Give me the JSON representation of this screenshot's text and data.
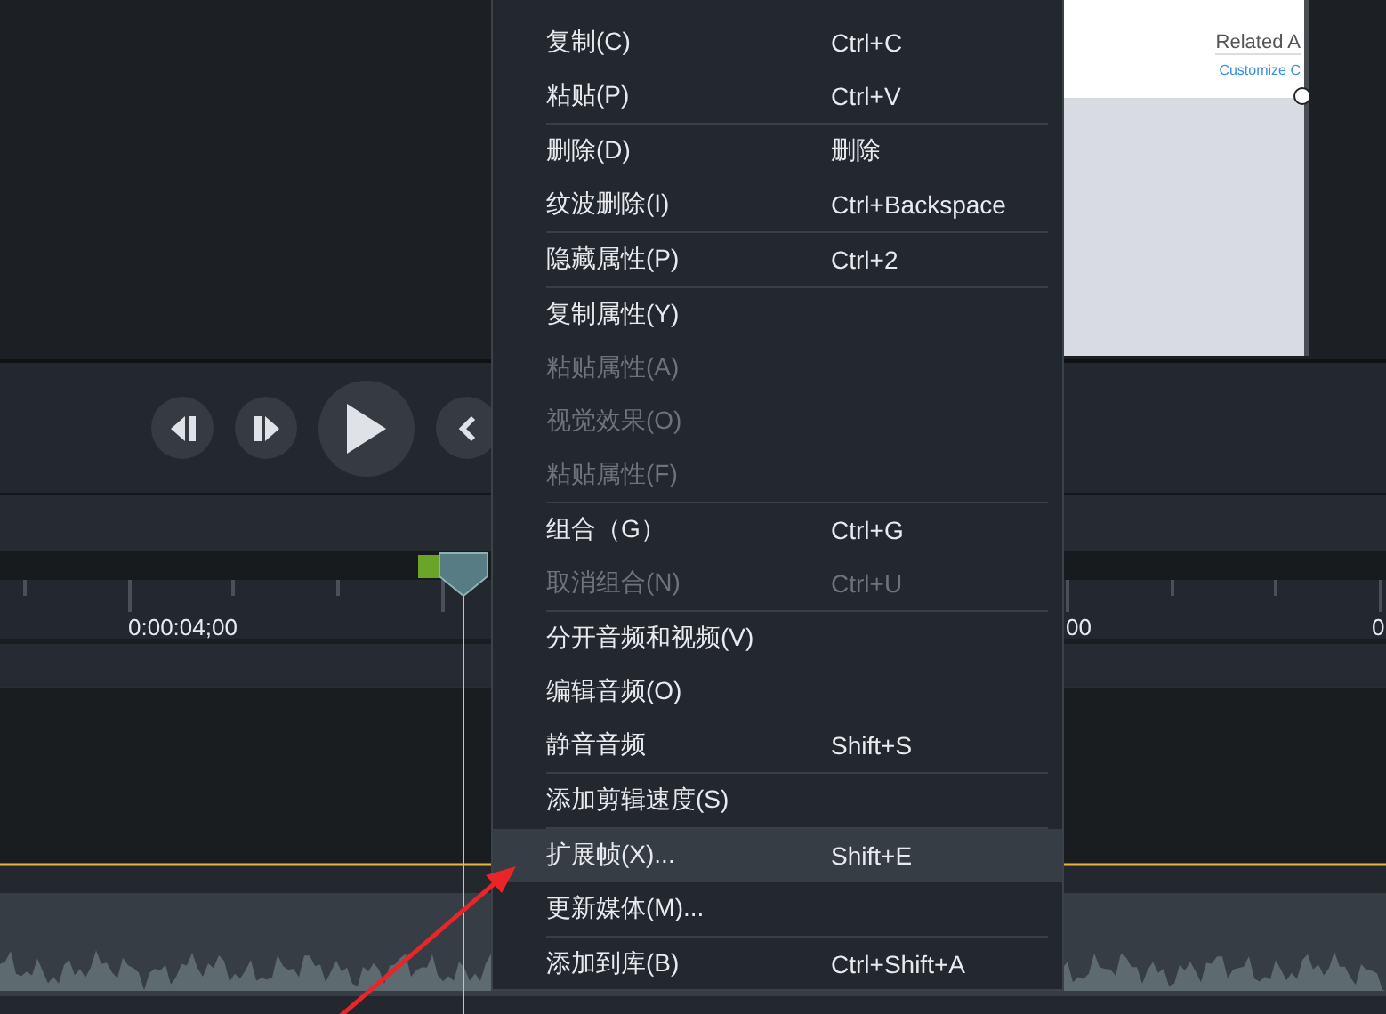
{
  "preview": {
    "canvas_texts": [
      {
        "kind": "heading",
        "text": "Related A"
      },
      {
        "kind": "link",
        "text": "Customize C"
      }
    ]
  },
  "timeline": {
    "ruler_labels": [
      "0:00:04;00",
      "00",
      "0"
    ]
  },
  "context_menu": {
    "groups": [
      [
        {
          "label": "复制(C)",
          "shortcut": "Ctrl+C",
          "disabled": false,
          "selected": false
        },
        {
          "label": "粘贴(P)",
          "shortcut": "Ctrl+V",
          "disabled": false,
          "selected": false
        }
      ],
      [
        {
          "label": "删除(D)",
          "shortcut": "删除",
          "disabled": false,
          "selected": false
        },
        {
          "label": "纹波删除(I)",
          "shortcut": "Ctrl+Backspace",
          "disabled": false,
          "selected": false
        }
      ],
      [
        {
          "label": "隐藏属性(P)",
          "shortcut": "Ctrl+2",
          "disabled": false,
          "selected": false
        }
      ],
      [
        {
          "label": "复制属性(Y)",
          "disabled": false,
          "selected": false
        },
        {
          "label": "粘贴属性(A)",
          "disabled": true,
          "selected": false
        },
        {
          "label": "视觉效果(O)",
          "disabled": true,
          "selected": false
        },
        {
          "label": "粘贴属性(F)",
          "disabled": true,
          "selected": false
        }
      ],
      [
        {
          "label": "组合（G）",
          "shortcut": "Ctrl+G",
          "disabled": false,
          "selected": false
        },
        {
          "label": "取消组合(N)",
          "shortcut": "Ctrl+U",
          "disabled": true,
          "selected": false
        }
      ],
      [
        {
          "label": "分开音频和视频(V)",
          "disabled": false,
          "selected": false
        },
        {
          "label": "编辑音频(O)",
          "disabled": false,
          "selected": false
        },
        {
          "label": "静音音频",
          "shortcut": "Shift+S",
          "disabled": false,
          "selected": false
        }
      ],
      [
        {
          "label": "添加剪辑速度(S)",
          "disabled": false,
          "selected": false
        }
      ],
      [
        {
          "label": "扩展帧(X)...",
          "shortcut": "Shift+E",
          "disabled": false,
          "selected": true
        },
        {
          "label": "更新媒体(M)...",
          "disabled": false,
          "selected": false
        }
      ],
      [
        {
          "label": "添加到库(B)",
          "shortcut": "Ctrl+Shift+A",
          "disabled": false,
          "selected": false
        }
      ]
    ]
  }
}
